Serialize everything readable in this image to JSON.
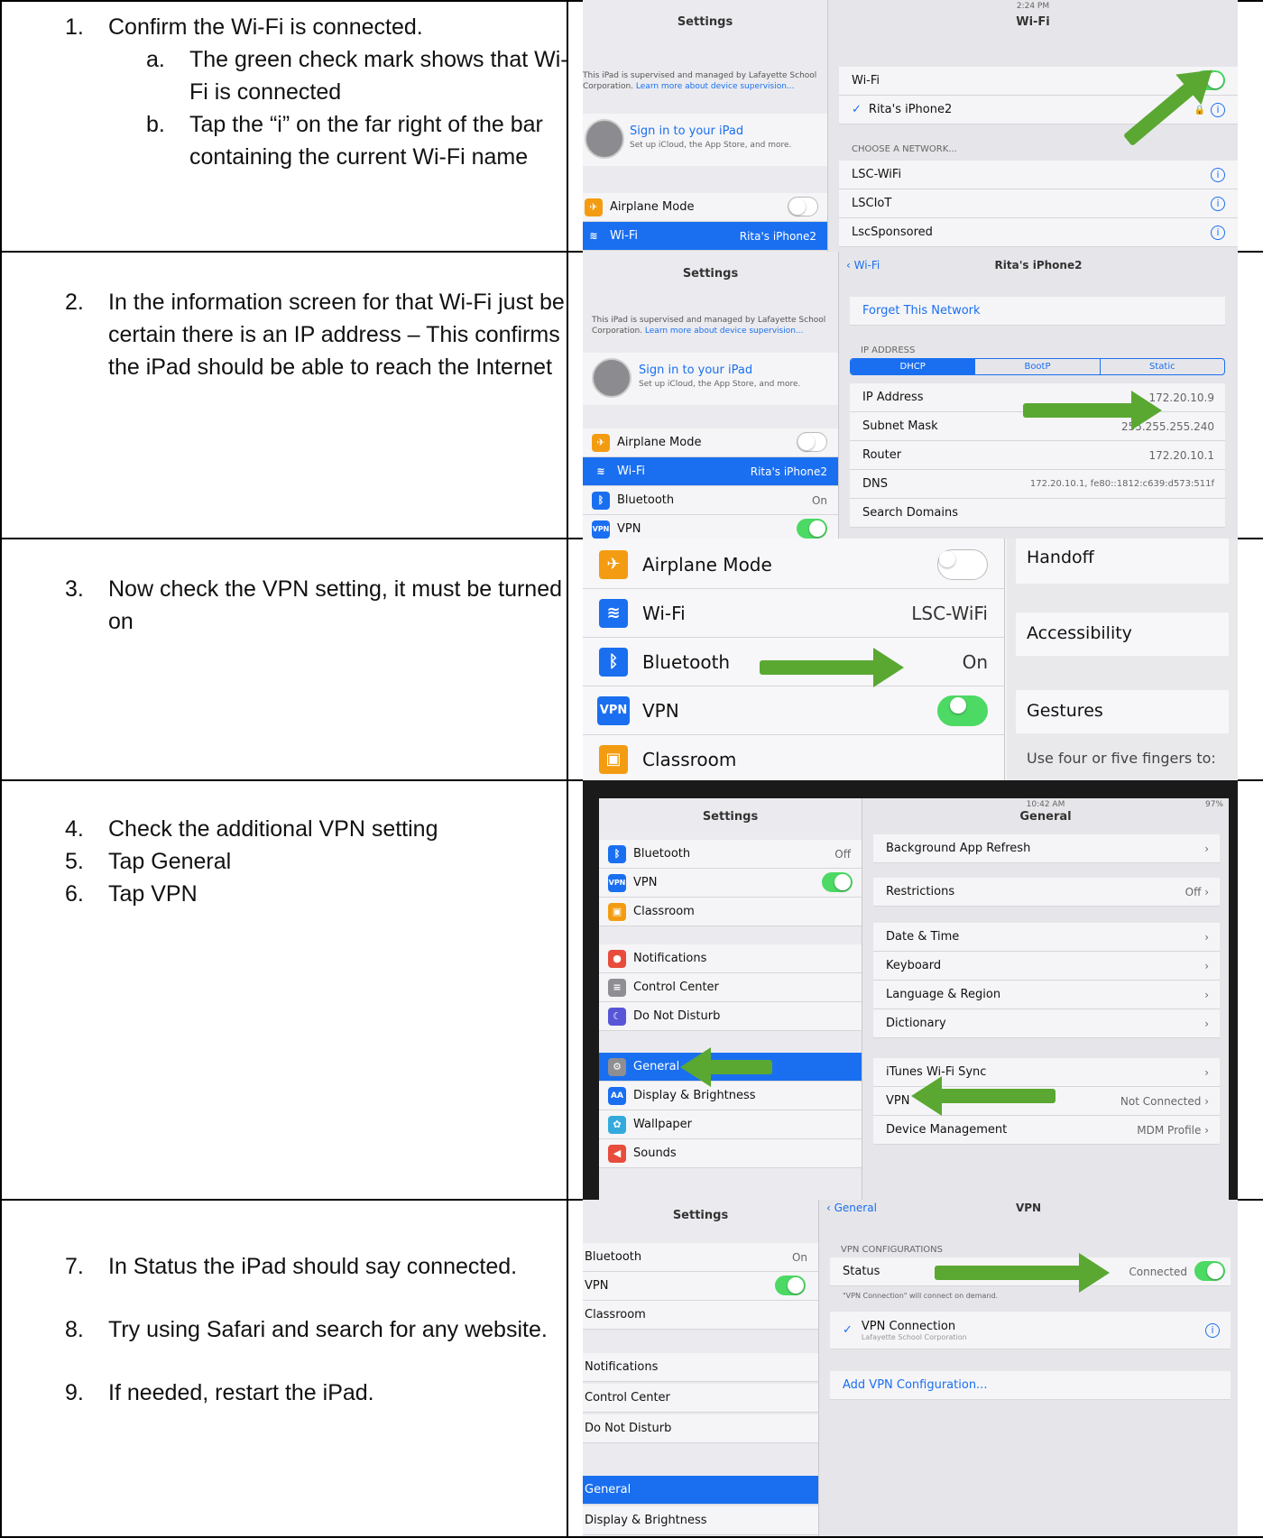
{
  "rows": [
    {
      "steps": [
        {
          "num": "1.",
          "text": "Confirm the Wi-Fi is connected."
        }
      ],
      "substeps": [
        {
          "num": "a.",
          "text": "The green check mark shows that Wi-Fi is connected"
        },
        {
          "num": "b.",
          "text": "Tap the “i” on the far right of the bar containing the current Wi-Fi name"
        }
      ],
      "screen": {
        "sidebar_title": "Settings",
        "detail_title": "Wi-Fi",
        "supervision_note": "This iPad is supervised and managed by Lafayette School Corporation.",
        "supervision_link": "Learn more about device supervision...",
        "sign_in_title": "Sign in to your iPad",
        "sign_in_sub": "Set up iCloud, the App Store, and more.",
        "airplane_label": "Airplane Mode",
        "wifi_label": "Wi-Fi",
        "wifi_value": "Rita's iPhone2",
        "wifi_row": "Wi-Fi",
        "connected_network": "Rita's iPhone2",
        "choose_header": "CHOOSE A NETWORK...",
        "networks": [
          "LSC-WiFi",
          "LSCIoT",
          "LscSponsored"
        ],
        "time": "2:24 PM"
      }
    },
    {
      "steps": [
        {
          "num": "2.",
          "text": "In the information screen for that Wi-Fi just be certain there is an IP address – This confirms the iPad should be able to reach the Internet"
        }
      ],
      "screen": {
        "sidebar_title": "Settings",
        "back_label": "Wi-Fi",
        "detail_title": "Rita's iPhone2",
        "supervision_note": "This iPad is supervised and managed by Lafayette School Corporation.",
        "supervision_link": "Learn more about device supervision...",
        "sign_in_title": "Sign in to your iPad",
        "sign_in_sub": "Set up iCloud, the App Store, and more.",
        "forget_label": "Forget This Network",
        "ip_header": "IP ADDRESS",
        "seg_options": [
          "DHCP",
          "BootP",
          "Static"
        ],
        "fields": [
          {
            "label": "IP Address",
            "value": "172.20.10.9"
          },
          {
            "label": "Subnet Mask",
            "value": "255.255.255.240"
          },
          {
            "label": "Router",
            "value": "172.20.10.1"
          },
          {
            "label": "DNS",
            "value": "172.20.10.1, fe80::1812:c639:d573:511f"
          },
          {
            "label": "Search Domains",
            "value": ""
          }
        ],
        "side_rows": [
          {
            "label": "Airplane Mode",
            "value": ""
          },
          {
            "label": "Wi-Fi",
            "value": "Rita's iPhone2"
          },
          {
            "label": "Bluetooth",
            "value": "On"
          },
          {
            "label": "VPN",
            "value": ""
          }
        ]
      }
    },
    {
      "steps": [
        {
          "num": "3.",
          "text": "Now check the VPN setting, it must be turned on"
        }
      ],
      "screen": {
        "side_rows": [
          {
            "label": "Airplane Mode",
            "value": ""
          },
          {
            "label": "Wi-Fi",
            "value": "LSC-WiFi"
          },
          {
            "label": "Bluetooth",
            "value": "On"
          },
          {
            "label": "VPN",
            "value": ""
          },
          {
            "label": "Classroom",
            "value": ""
          }
        ],
        "right_items": [
          "Handoff",
          "Accessibility",
          "Gestures"
        ],
        "right_note": "Use four or five fingers to:",
        "vpn_badge": "VPN"
      }
    },
    {
      "steps": [
        {
          "num": "4.",
          "text": "Check the additional VPN setting"
        },
        {
          "num": "5.",
          "text": "Tap General"
        },
        {
          "num": "6.",
          "text": "Tap VPN"
        }
      ],
      "screen": {
        "time": "10:42 AM",
        "battery": "97%",
        "sidebar_title": "Settings",
        "detail_title": "General",
        "side_rows": [
          {
            "label": "Bluetooth",
            "value": "Off"
          },
          {
            "label": "VPN",
            "value": ""
          },
          {
            "label": "Classroom",
            "value": ""
          },
          {
            "label": "Notifications",
            "value": ""
          },
          {
            "label": "Control Center",
            "value": ""
          },
          {
            "label": "Do Not Disturb",
            "value": ""
          },
          {
            "label": "General",
            "value": ""
          },
          {
            "label": "Display & Brightness",
            "value": ""
          },
          {
            "label": "Wallpaper",
            "value": ""
          },
          {
            "label": "Sounds",
            "value": ""
          }
        ],
        "detail_rows": [
          {
            "label": "Background App Refresh",
            "value": ""
          },
          {
            "label": "Restrictions",
            "value": "Off"
          },
          {
            "label": "Date & Time",
            "value": ""
          },
          {
            "label": "Keyboard",
            "value": ""
          },
          {
            "label": "Language & Region",
            "value": ""
          },
          {
            "label": "Dictionary",
            "value": ""
          },
          {
            "label": "iTunes Wi-Fi Sync",
            "value": ""
          },
          {
            "label": "VPN",
            "value": "Not Connected"
          },
          {
            "label": "Device Management",
            "value": "MDM Profile"
          }
        ]
      }
    },
    {
      "steps": [
        {
          "num": "7.",
          "text": "In Status the iPad should say connected."
        },
        {
          "num": "8.",
          "text": "Try using Safari and search for any website."
        },
        {
          "num": "9.",
          "text": "If needed, restart the iPad."
        }
      ],
      "screen": {
        "sidebar_title": "Settings",
        "back_label": "General",
        "detail_title": "VPN",
        "side_rows": [
          {
            "label": "Bluetooth",
            "value": "On"
          },
          {
            "label": "VPN",
            "value": ""
          },
          {
            "label": "Classroom",
            "value": ""
          },
          {
            "label": "Notifications",
            "value": ""
          },
          {
            "label": "Control Center",
            "value": ""
          },
          {
            "label": "Do Not Disturb",
            "value": ""
          },
          {
            "label": "General",
            "value": ""
          },
          {
            "label": "Display & Brightness",
            "value": ""
          }
        ],
        "config_header": "VPN CONFIGURATIONS",
        "status_label": "Status",
        "status_value": "Connected",
        "demand_note": "\"VPN Connection\" will connect on demand.",
        "vpn_name": "VPN Connection",
        "vpn_sub": "Lafayette School Corporation",
        "add_config": "Add VPN Configuration..."
      }
    }
  ]
}
